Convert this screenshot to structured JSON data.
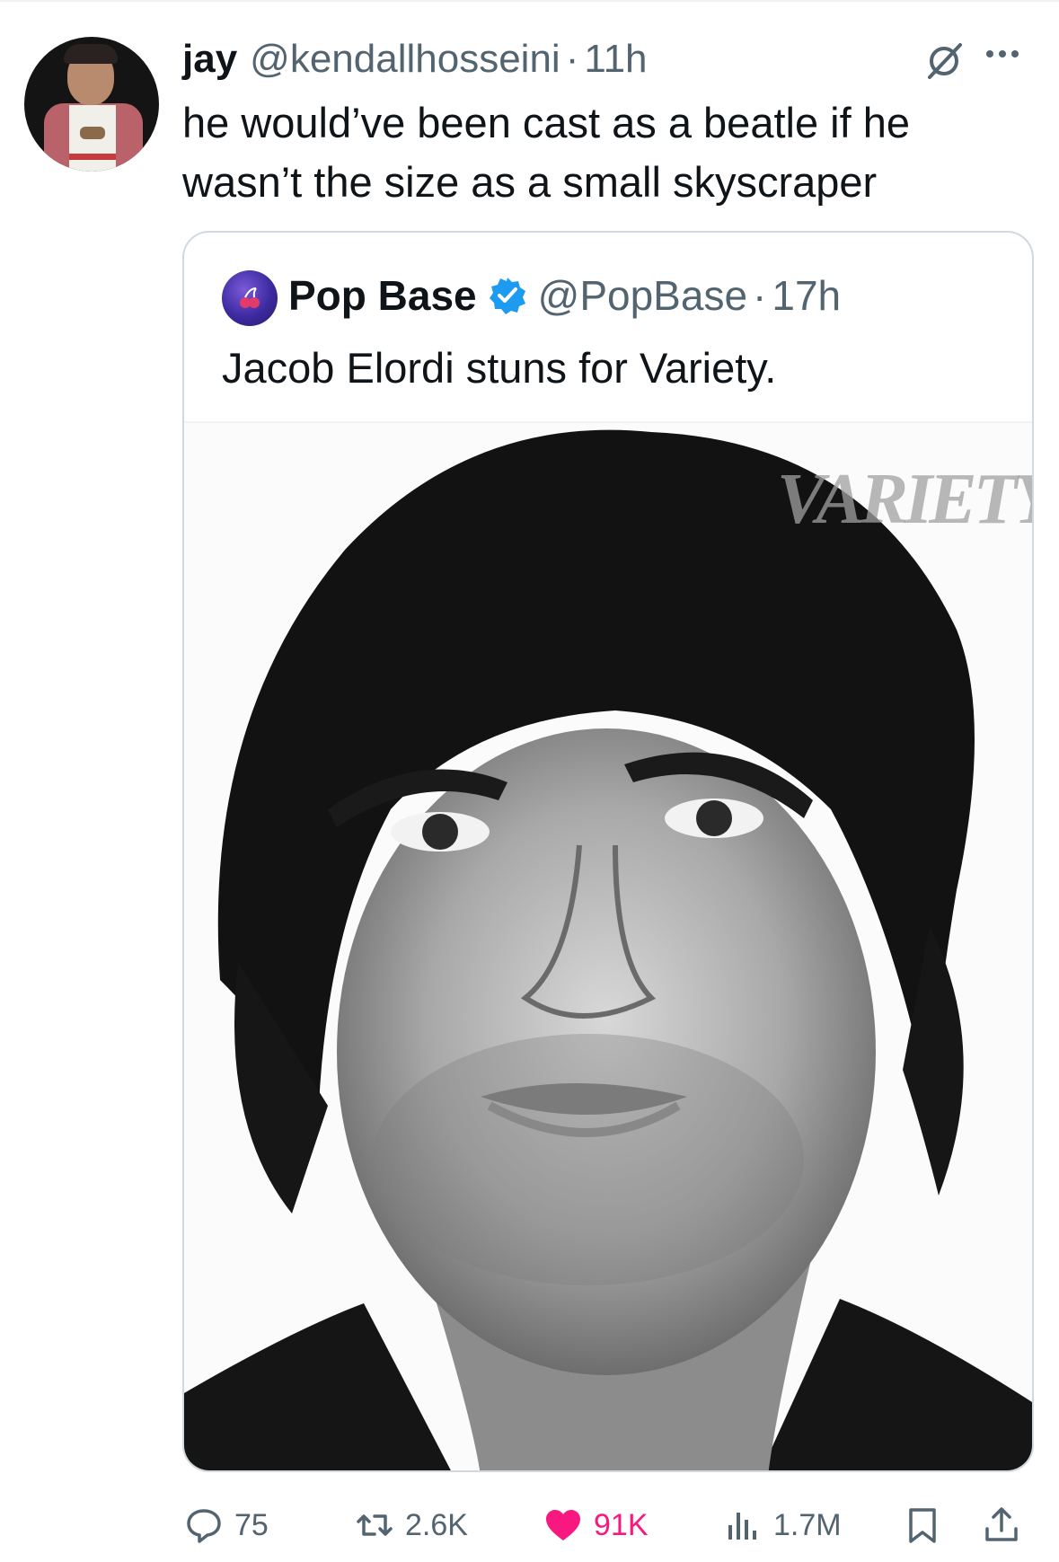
{
  "tweet": {
    "author_name": "jay",
    "author_handle": "@kendallhosseini",
    "separator": "·",
    "time": "11h",
    "text": "he would’ve been cast as a beatle if he wasn’t the size as a small skyscraper"
  },
  "quoted_tweet": {
    "author_name": "Pop Base",
    "author_handle": "@PopBase",
    "separator": "·",
    "time": "17h",
    "text": "Jacob Elordi stuns for Variety.",
    "media_watermark": "VARIETY"
  },
  "actions": {
    "replies": "75",
    "reposts": "2.6K",
    "likes": "91K",
    "views": "1.7M"
  },
  "icons": {
    "reply": "reply-icon",
    "repost": "repost-icon",
    "like": "heart-icon",
    "views": "views-icon",
    "bookmark": "bookmark-icon",
    "share": "share-icon",
    "grok": "grok-icon",
    "more": "more-icon",
    "verified": "verified-badge-icon"
  },
  "colors": {
    "text": "#0f1419",
    "secondary": "#536471",
    "like": "#f91880",
    "verified": "#1d9bf0",
    "border": "#cfd9de"
  }
}
